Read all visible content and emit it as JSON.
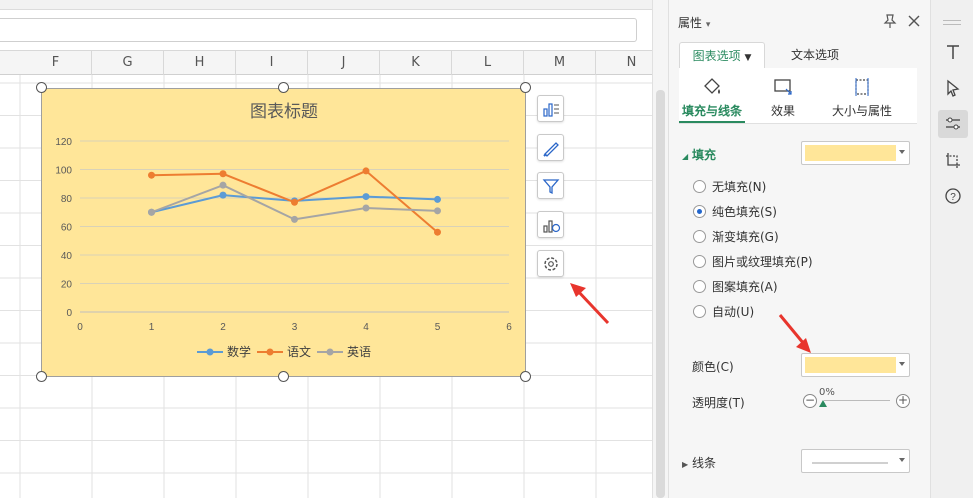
{
  "sheet": {
    "columns": [
      "F",
      "G",
      "H",
      "I",
      "J",
      "K",
      "L",
      "M",
      "N"
    ]
  },
  "chart": {
    "title": "图表标题",
    "fill_color": "#ffe699",
    "tools": [
      "chart-elements-icon",
      "chart-style-icon",
      "chart-filter-icon",
      "chart-layout-icon",
      "chart-settings-icon"
    ]
  },
  "chart_data": {
    "type": "line",
    "title": "图表标题",
    "xlim": [
      0,
      6
    ],
    "ylim": [
      0,
      120
    ],
    "x_ticks": [
      "0",
      "1",
      "2",
      "3",
      "4",
      "5",
      "6"
    ],
    "y_ticks": [
      "0",
      "20",
      "40",
      "60",
      "80",
      "100",
      "120"
    ],
    "grid": true,
    "legend": "bottom",
    "series": [
      {
        "name": "数学",
        "color": "#5b9bd5",
        "x": [
          1,
          2,
          3,
          4,
          5
        ],
        "values": [
          70,
          82,
          78,
          81,
          79
        ]
      },
      {
        "name": "语文",
        "color": "#ed7d31",
        "x": [
          1,
          2,
          3,
          4,
          5
        ],
        "values": [
          96,
          97,
          77,
          99,
          56
        ]
      },
      {
        "name": "英语",
        "color": "#a5a5a5",
        "x": [
          1,
          2,
          3,
          4,
          5
        ],
        "values": [
          70,
          89,
          65,
          73,
          71
        ]
      }
    ]
  },
  "panel": {
    "title": "属性",
    "tabs": {
      "chart_options": "图表选项",
      "text_options": "文本选项"
    },
    "subtabs": {
      "fill_line": "填充与线条",
      "effects": "效果",
      "size_props": "大小与属性"
    },
    "fill_section": "填充",
    "fill_options": [
      {
        "label": "无填充(N)",
        "selected": false
      },
      {
        "label": "纯色填充(S)",
        "selected": true
      },
      {
        "label": "渐变填充(G)",
        "selected": false
      },
      {
        "label": "图片或纹理填充(P)",
        "selected": false
      },
      {
        "label": "图案填充(A)",
        "selected": false
      },
      {
        "label": "自动(U)",
        "selected": false
      }
    ],
    "color_label": "颜色(C)",
    "opacity_label": "透明度(T)",
    "opacity_value": "0%",
    "opacity_fraction": 0,
    "line_section": "线条",
    "selected_color": "#ffe699"
  },
  "rightbar": {
    "items": [
      "text-tool-icon",
      "select-cursor-icon",
      "properties-icon",
      "crop-icon",
      "help-icon"
    ]
  }
}
